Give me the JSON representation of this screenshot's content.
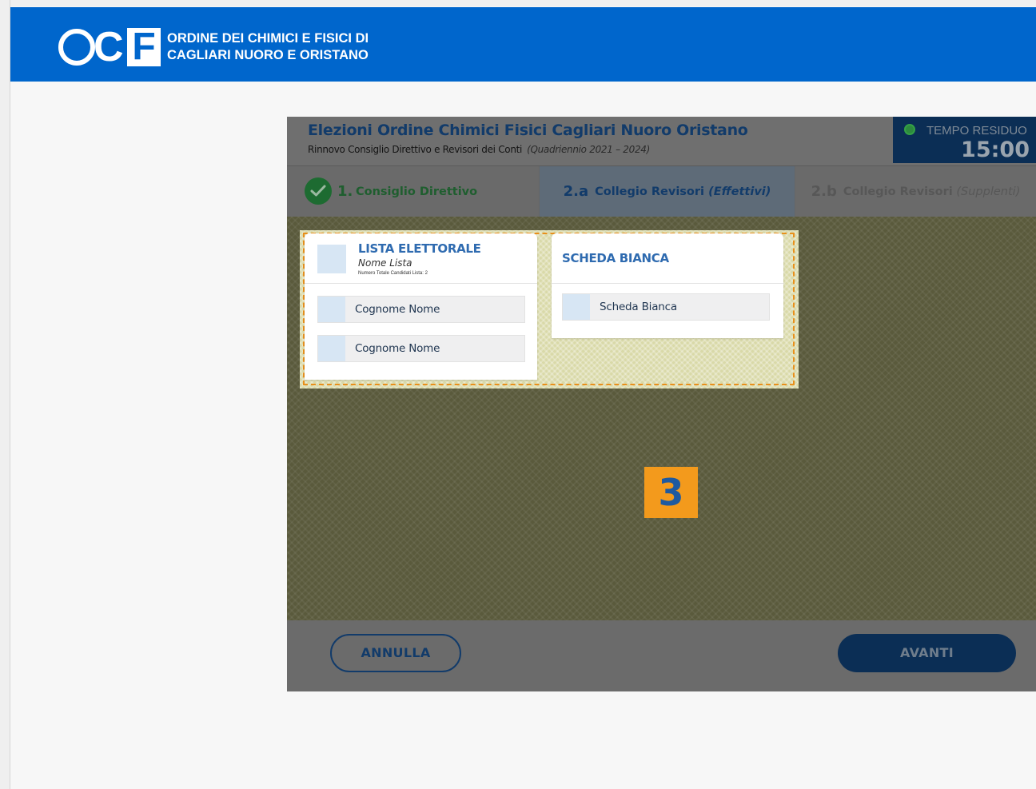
{
  "header": {
    "logo_text": "OCF",
    "org_line1": "ORDINE DEI CHIMICI E FISICI DI",
    "org_line2": "CAGLIARI NUORO E ORISTANO",
    "color": "#0066cc"
  },
  "election": {
    "title": "Elezioni Ordine Chimici Fisici Cagliari Nuoro Oristano",
    "subtitle": "Rinnovo Consiglio Direttivo e Revisori dei Conti",
    "period": "(Quadriennio 2021 – 2024)"
  },
  "timer": {
    "label": "TEMPO RESIDUO",
    "value": "15:00"
  },
  "steps": [
    {
      "number": "1.",
      "label": "Consiglio Direttivo",
      "status": "completed"
    },
    {
      "number": "2.a",
      "label": "Collegio Revisori",
      "qualifier": "(Effettivi)",
      "status": "active"
    },
    {
      "number": "2.b",
      "label": "Collegio Revisori",
      "qualifier": "(Supplenti)",
      "status": "pending"
    }
  ],
  "lista": {
    "title": "LISTA ELETTORALE",
    "name": "Nome Lista",
    "count_label": "Numero Totale Candidati Lista: 2",
    "candidates": [
      "Cognome Nome",
      "Cognome Nome"
    ]
  },
  "bianca": {
    "title": "SCHEDA BIANCA",
    "option": "Scheda Bianca"
  },
  "badge": "3",
  "footer": {
    "cancel_label": "ANNULLA",
    "next_label": "AVANTI"
  },
  "colors": {
    "brand_blue": "#0066cc",
    "dark_navy": "#0b2e55",
    "highlight_orange": "#f39a1c",
    "check_green": "#1d6b31"
  }
}
